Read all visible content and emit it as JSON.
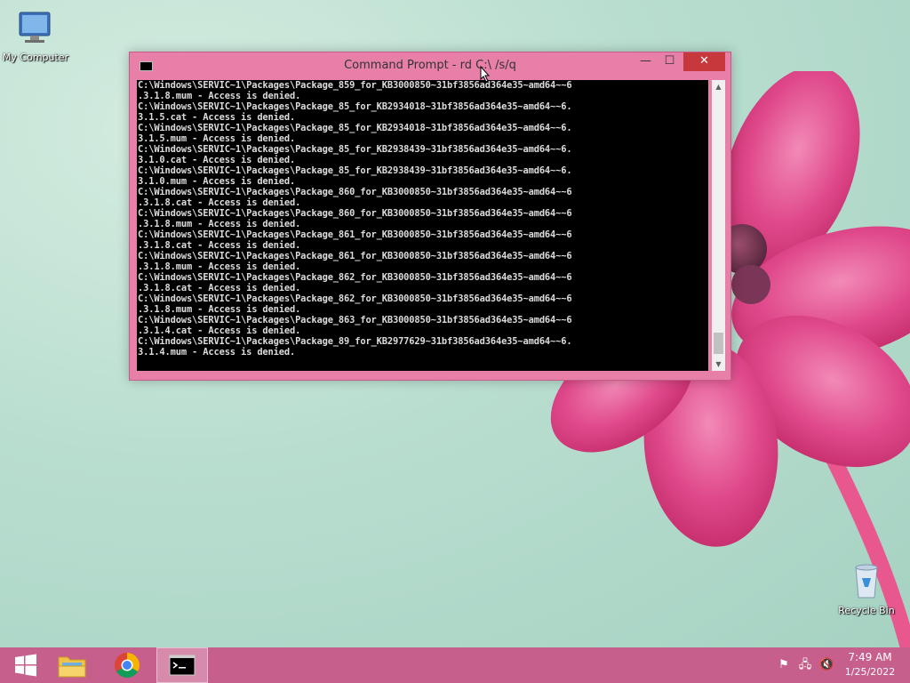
{
  "desktop": {
    "icons": [
      {
        "label": "My Computer"
      },
      {
        "label": "Recycle Bin"
      }
    ]
  },
  "window": {
    "title": "Command Prompt - rd  C:\\ /s/q",
    "minimize_glyph": "—",
    "maximize_glyph": "☐",
    "close_glyph": "✕",
    "console_lines": [
      "C:\\Windows\\SERVIC~1\\Packages\\Package_859_for_KB3000850~31bf3856ad364e35~amd64~~6",
      ".3.1.8.mum - Access is denied.",
      "C:\\Windows\\SERVIC~1\\Packages\\Package_85_for_KB2934018~31bf3856ad364e35~amd64~~6.",
      "3.1.5.cat - Access is denied.",
      "C:\\Windows\\SERVIC~1\\Packages\\Package_85_for_KB2934018~31bf3856ad364e35~amd64~~6.",
      "3.1.5.mum - Access is denied.",
      "C:\\Windows\\SERVIC~1\\Packages\\Package_85_for_KB2938439~31bf3856ad364e35~amd64~~6.",
      "3.1.0.cat - Access is denied.",
      "C:\\Windows\\SERVIC~1\\Packages\\Package_85_for_KB2938439~31bf3856ad364e35~amd64~~6.",
      "3.1.0.mum - Access is denied.",
      "C:\\Windows\\SERVIC~1\\Packages\\Package_860_for_KB3000850~31bf3856ad364e35~amd64~~6",
      ".3.1.8.cat - Access is denied.",
      "C:\\Windows\\SERVIC~1\\Packages\\Package_860_for_KB3000850~31bf3856ad364e35~amd64~~6",
      ".3.1.8.mum - Access is denied.",
      "C:\\Windows\\SERVIC~1\\Packages\\Package_861_for_KB3000850~31bf3856ad364e35~amd64~~6",
      ".3.1.8.cat - Access is denied.",
      "C:\\Windows\\SERVIC~1\\Packages\\Package_861_for_KB3000850~31bf3856ad364e35~amd64~~6",
      ".3.1.8.mum - Access is denied.",
      "C:\\Windows\\SERVIC~1\\Packages\\Package_862_for_KB3000850~31bf3856ad364e35~amd64~~6",
      ".3.1.8.cat - Access is denied.",
      "C:\\Windows\\SERVIC~1\\Packages\\Package_862_for_KB3000850~31bf3856ad364e35~amd64~~6",
      ".3.1.8.mum - Access is denied.",
      "C:\\Windows\\SERVIC~1\\Packages\\Package_863_for_KB3000850~31bf3856ad364e35~amd64~~6",
      ".3.1.4.cat - Access is denied.",
      "C:\\Windows\\SERVIC~1\\Packages\\Package_89_for_KB2977629~31bf3856ad364e35~amd64~~6.",
      "3.1.4.mum - Access is denied."
    ]
  },
  "taskbar": {
    "apps": [
      {
        "name": "start"
      },
      {
        "name": "file-explorer"
      },
      {
        "name": "chrome"
      },
      {
        "name": "command-prompt",
        "active": true
      }
    ],
    "clock": {
      "time": "7:49 AM",
      "date": "1/25/2022"
    }
  },
  "colors": {
    "taskbar": "#c75f8d",
    "window_frame": "#e77fa8",
    "close_button": "#c7383c"
  }
}
